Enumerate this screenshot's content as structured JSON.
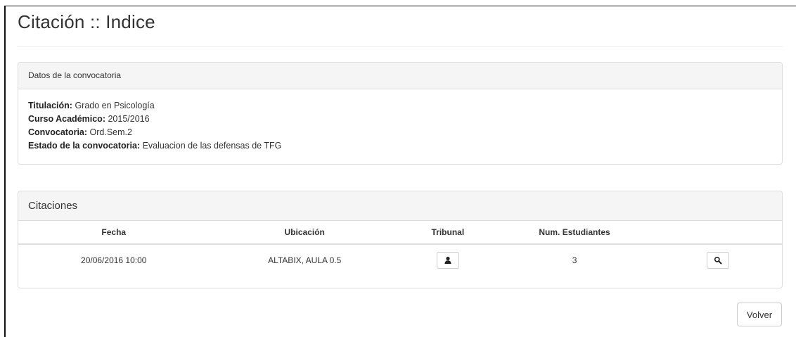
{
  "page": {
    "title": "Citación :: Indice"
  },
  "convocatoria": {
    "heading": "Datos de la convocatoria",
    "fields": [
      {
        "label": "Titulación:",
        "value": "Grado en Psicología"
      },
      {
        "label": "Curso Académico:",
        "value": "2015/2016"
      },
      {
        "label": "Convocatoria:",
        "value": "Ord.Sem.2"
      },
      {
        "label": "Estado de la convocatoria:",
        "value": "Evaluacion de las defensas de TFG"
      }
    ]
  },
  "citaciones": {
    "heading": "Citaciones",
    "columns": {
      "fecha": "Fecha",
      "ubicacion": "Ubicación",
      "tribunal": "Tribunal",
      "num_estudiantes": "Num. Estudiantes"
    },
    "rows": [
      {
        "fecha": "20/06/2016 10:00",
        "ubicacion": "ALTABIX, AULA 0.5",
        "tribunal_icon": "user-icon",
        "num_estudiantes": "3",
        "action_icon": "search-icon"
      }
    ]
  },
  "footer": {
    "volver_label": "Volver"
  }
}
